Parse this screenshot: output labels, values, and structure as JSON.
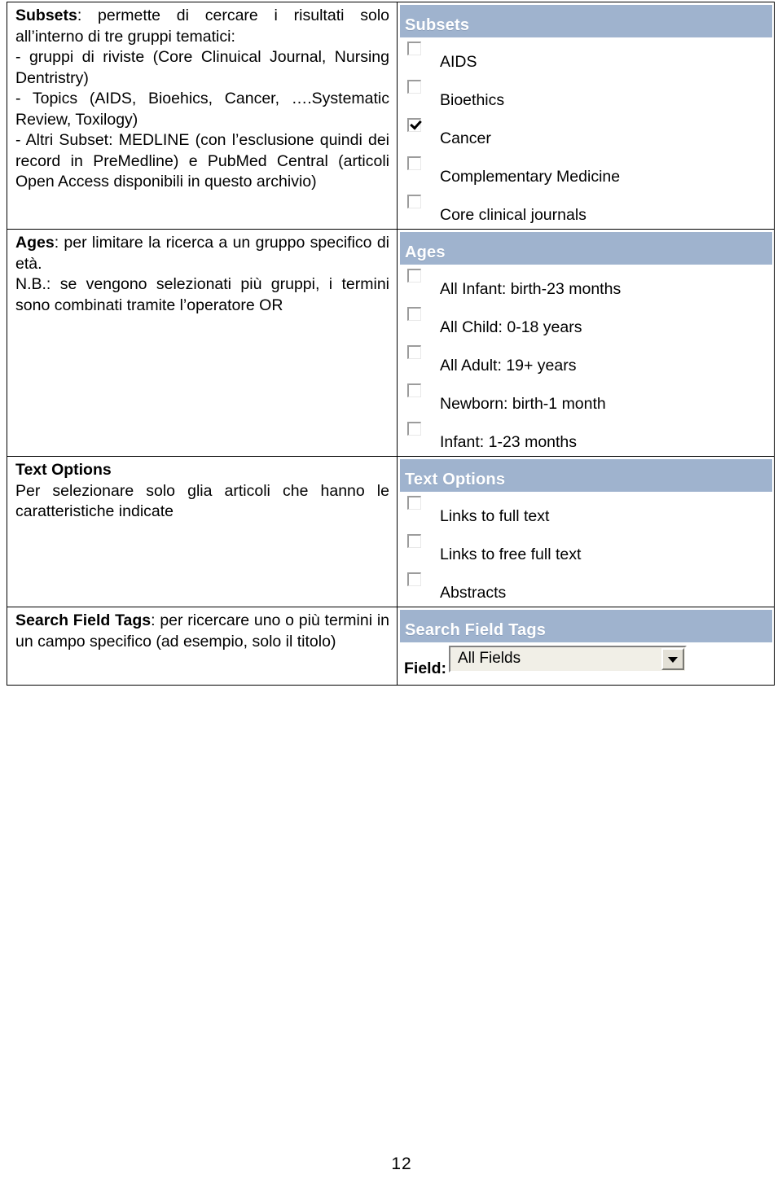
{
  "page": {
    "number": "12"
  },
  "rows": [
    {
      "left": {
        "blocks": [
          {
            "bold": "Subsets",
            "rest": ": permette di cercare i risultati solo all’interno di tre gruppi tematici:"
          },
          {
            "bold": "",
            "rest": "- gruppi di riviste (Core Clinuical Journal, Nursing Dentristry)"
          },
          {
            "bold": "",
            "rest": "- Topics (AIDS, Bioehics, Cancer, ….Systematic Review, Toxilogy)"
          },
          {
            "bold": "",
            "rest": "- Altri Subset: MEDLINE (con l’esclusione quindi dei record in PreMedline) e PubMed Central (articoli Open Access disponibili in questo archivio)"
          }
        ]
      },
      "panel": {
        "header": "Subsets",
        "options": [
          {
            "label": "AIDS",
            "checked": false
          },
          {
            "label": "Bioethics",
            "checked": false
          },
          {
            "label": "Cancer",
            "checked": true
          },
          {
            "label": "Complementary Medicine",
            "checked": false
          },
          {
            "label": "Core clinical journals",
            "checked": false
          }
        ]
      }
    },
    {
      "left": {
        "blocks": [
          {
            "bold": "Ages",
            "rest": ": per limitare la ricerca a un gruppo specifico di età."
          },
          {
            "bold": "",
            "rest": "N.B.: se vengono selezionati più gruppi, i termini sono combinati tramite l’operatore OR"
          }
        ]
      },
      "panel": {
        "header": "Ages",
        "options": [
          {
            "label": "All Infant: birth-23 months",
            "checked": false
          },
          {
            "label": "All Child: 0-18 years",
            "checked": false
          },
          {
            "label": "All Adult: 19+ years",
            "checked": false
          },
          {
            "label": "Newborn: birth-1 month",
            "checked": false
          },
          {
            "label": "Infant: 1-23 months",
            "checked": false
          }
        ]
      }
    },
    {
      "left": {
        "blocks": [
          {
            "bold": "Text Options",
            "rest": ""
          },
          {
            "bold": "",
            "rest": "Per selezionare solo glia articoli che hanno le caratteristiche indicate"
          }
        ]
      },
      "panel": {
        "header": "Text Options",
        "options": [
          {
            "label": "Links to full text",
            "checked": false
          },
          {
            "label": "Links to free full text",
            "checked": false
          },
          {
            "label": "Abstracts",
            "checked": false
          }
        ]
      }
    },
    {
      "left": {
        "blocks": [
          {
            "bold": "Search Field Tags",
            "rest": ": per ricercare uno o più termini in un campo specifico (ad esempio, solo il titolo)"
          }
        ]
      },
      "panel": {
        "header": "Search Field Tags",
        "field": {
          "label": "Field:",
          "value": "All Fields"
        }
      }
    }
  ],
  "colors": {
    "header_bar": "#9fb3ce",
    "header_text": "#ffffff",
    "page_background": "#ffffff",
    "border": "#000000",
    "select_face": "#f1efe7"
  }
}
